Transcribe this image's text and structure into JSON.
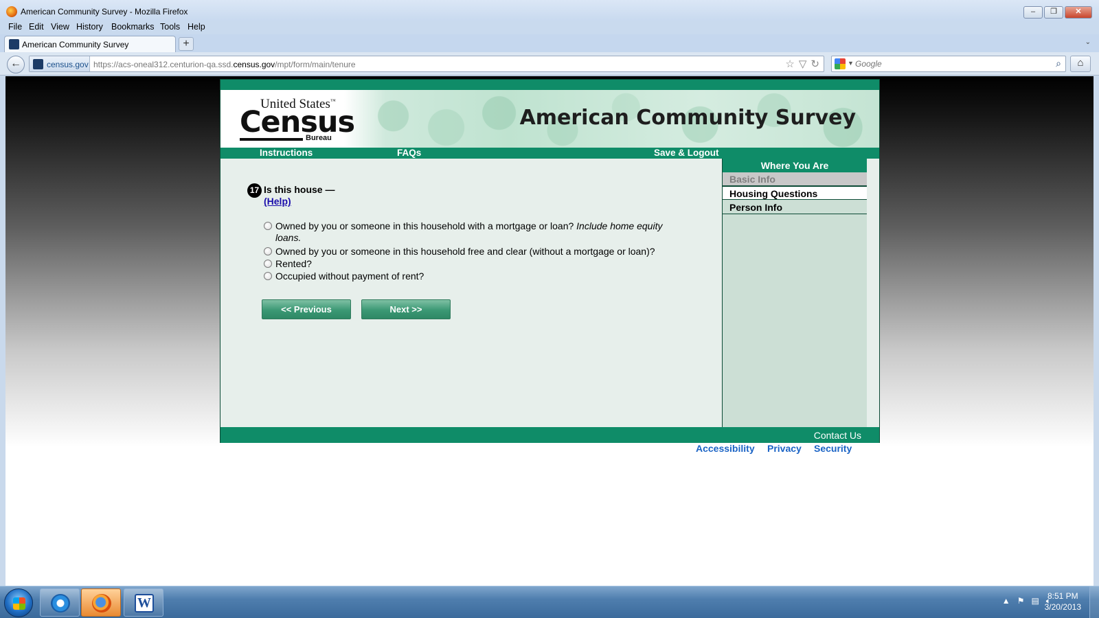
{
  "window": {
    "title": "American Community Survey - Mozilla Firefox",
    "controls": [
      "minimize",
      "restore",
      "close"
    ]
  },
  "menu": [
    "File",
    "Edit",
    "View",
    "History",
    "Bookmarks",
    "Tools",
    "Help"
  ],
  "tabs": [
    {
      "label": "American Community Survey"
    }
  ],
  "navbar": {
    "site_badge": "census.gov",
    "url_prefix": "https://acs-oneal312.centurion-qa.ssd.",
    "url_domain": "census.gov",
    "url_suffix": "/mpt/form/main/tenure",
    "search_placeholder": "Google"
  },
  "page": {
    "logo": {
      "line1": "United States",
      "line2": "Census",
      "line3": "Bureau"
    },
    "survey_title": "American Community Survey",
    "nav": [
      {
        "label": "Instructions"
      },
      {
        "label": "FAQs"
      },
      {
        "label": "Save & Logout"
      }
    ],
    "question": {
      "number": "17",
      "text": "Is this house —",
      "help": "(Help)",
      "options": [
        {
          "text": "Owned by you or someone in this household with a mortgage or loan? ",
          "emphasis": "Include home equity loans.",
          "selected": false
        },
        {
          "text": "Owned by you or someone in this household free and clear (without a mortgage or loan)?",
          "emphasis": "",
          "selected": false
        },
        {
          "text": "Rented?",
          "emphasis": "",
          "selected": false
        },
        {
          "text": "Occupied without payment of rent?",
          "emphasis": "",
          "selected": false
        }
      ]
    },
    "buttons": {
      "previous": "<<   Previous",
      "next": "Next   >>"
    },
    "sidebar": {
      "title": "Where You Are",
      "items": [
        {
          "label": "Basic Info",
          "state": "done"
        },
        {
          "label": "Housing Questions",
          "state": "current"
        },
        {
          "label": "Person Info",
          "state": "pending"
        }
      ]
    },
    "footer": {
      "contact": "Contact Us"
    },
    "links": [
      "Accessibility",
      "Privacy",
      "Security"
    ]
  },
  "taskbar": {
    "pinned": [
      "internet-explorer-icon",
      "firefox-icon",
      "word-icon"
    ],
    "time": "8:51 PM",
    "date": "3/20/2013"
  },
  "colors": {
    "census_green": "#0f8c68",
    "content_bg": "#e7efeb",
    "sidebar_bg": "#ccdfd5",
    "link_blue": "#1a63c5"
  }
}
